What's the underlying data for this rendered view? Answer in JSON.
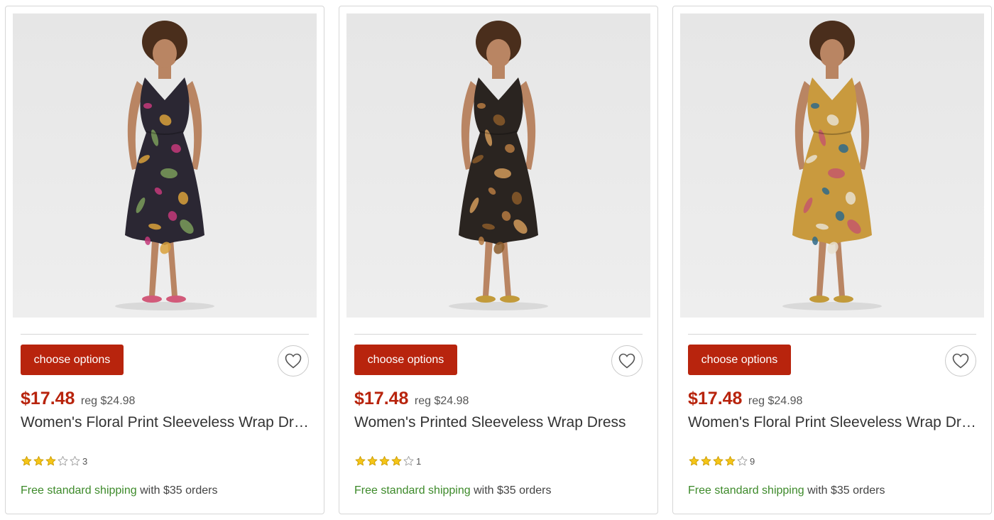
{
  "products": [
    {
      "button_label": "choose options",
      "price": "$17.48",
      "reg_price": "reg $24.98",
      "title": "Women's Floral Print Sleeveless Wrap Dress",
      "rating": 3,
      "rating_count": "3",
      "shipping_link": "Free standard shipping",
      "shipping_rest": " with $35 orders",
      "image": {
        "dress_color": "#2b2733",
        "print_colors": [
          "#c43a7a",
          "#d9a13b",
          "#7a9c5a"
        ],
        "hair_color": "#4a2e1c",
        "skin_color": "#b98563",
        "sandal_color": "#d25a7a"
      }
    },
    {
      "button_label": "choose options",
      "price": "$17.48",
      "reg_price": "reg $24.98",
      "title": "Women's Printed Sleeveless Wrap Dress",
      "rating": 4,
      "rating_count": "1",
      "shipping_link": "Free standard shipping",
      "shipping_rest": " with $35 orders",
      "image": {
        "dress_color": "#2a2420",
        "print_colors": [
          "#b57a42",
          "#8a5a2a",
          "#d19a5a"
        ],
        "hair_color": "#4a2e1c",
        "skin_color": "#b98563",
        "sandal_color": "#c29a3a"
      }
    },
    {
      "button_label": "choose options",
      "price": "$17.48",
      "reg_price": "reg $24.98",
      "title": "Women's Floral Print Sleeveless Wrap Dress",
      "rating": 4,
      "rating_count": "9",
      "shipping_link": "Free standard shipping",
      "shipping_rest": " with $35 orders",
      "image": {
        "dress_color": "#c99a3e",
        "print_colors": [
          "#2f6a8a",
          "#e8e0d0",
          "#c4586a"
        ],
        "hair_color": "#4a2e1c",
        "skin_color": "#b98563",
        "sandal_color": "#c29a3a"
      }
    }
  ],
  "colors": {
    "accent": "#b8240d",
    "shipping_green": "#3d8a2a",
    "star_gold": "#f5c518"
  },
  "icons": {
    "favorite": "heart-outline-icon",
    "star_filled": "star-filled-icon",
    "star_empty": "star-outline-icon"
  }
}
